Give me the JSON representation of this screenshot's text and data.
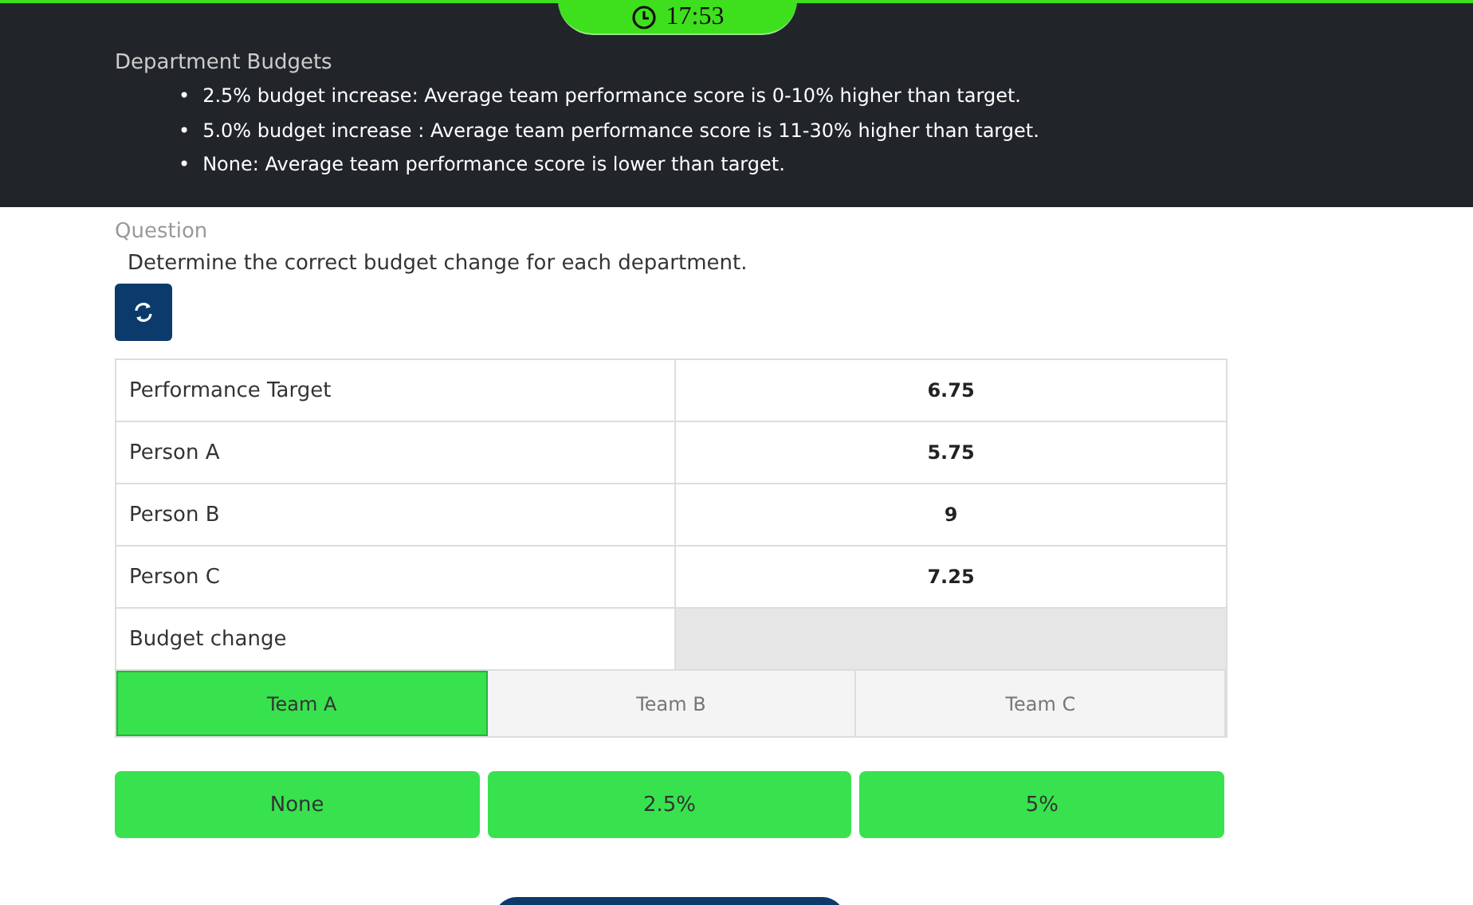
{
  "timer": {
    "time": "17:53"
  },
  "info": {
    "title": "Department Budgets",
    "bullets": [
      {
        "marker": "•",
        "text": "2.5% budget increase: Average team performance score is 0-10% higher than target."
      },
      {
        "marker": "•",
        "text": "5.0% budget increase : Average team performance score is 11-30% higher than target."
      },
      {
        "marker": "•",
        "text": "None: Average team performance score is lower than target."
      }
    ]
  },
  "question": {
    "label": "Question",
    "text": "Determine the correct budget change for each department."
  },
  "table": {
    "rows": [
      {
        "label": "Performance Target",
        "value": "6.75"
      },
      {
        "label": "Person A",
        "value": "5.75"
      },
      {
        "label": "Person B",
        "value": "9"
      },
      {
        "label": "Person C",
        "value": "7.25"
      },
      {
        "label": "Budget change",
        "value": null
      }
    ]
  },
  "tabs": [
    {
      "label": "Team A",
      "selected": true
    },
    {
      "label": "Team B",
      "selected": false
    },
    {
      "label": "Team C",
      "selected": false
    }
  ],
  "options": [
    "None",
    "2.5%",
    "5%"
  ]
}
